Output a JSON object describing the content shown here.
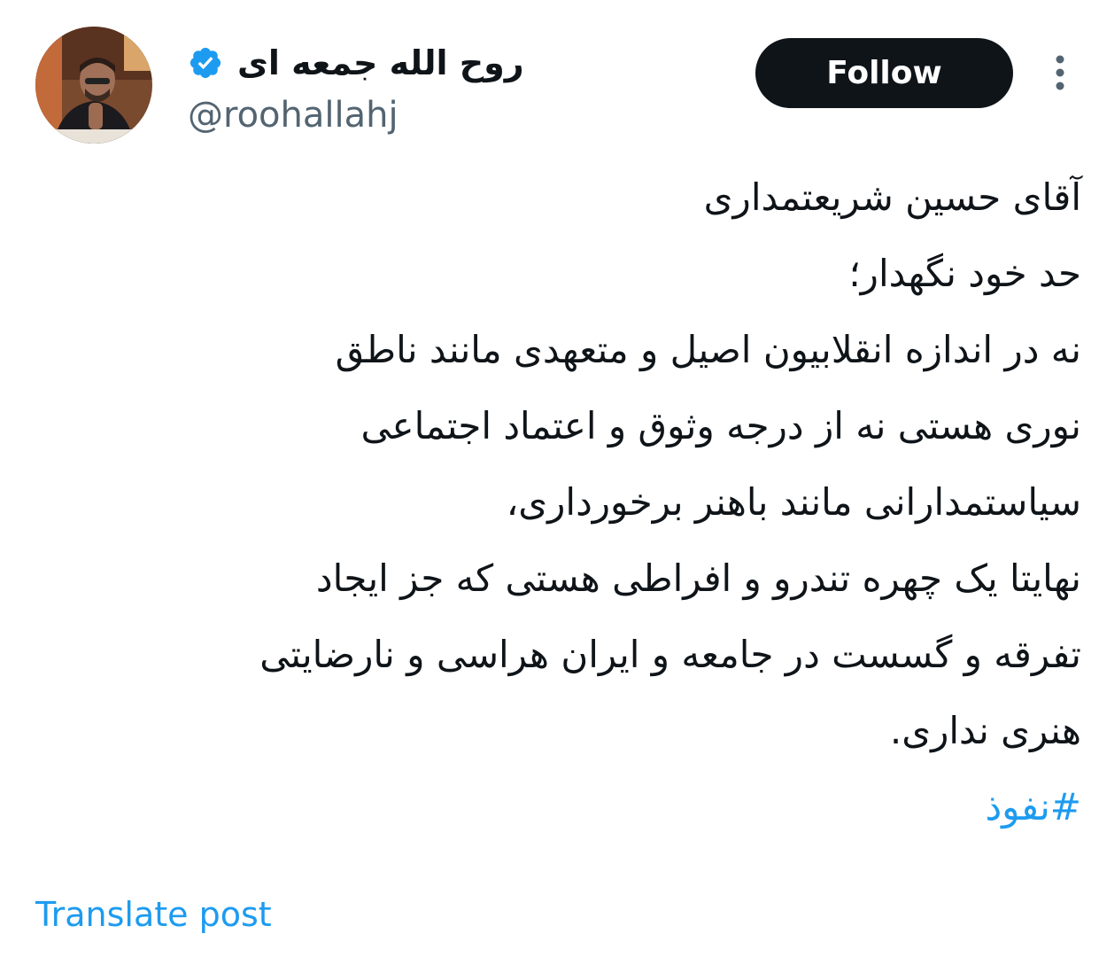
{
  "author": {
    "display_name": "روح الله جمعه ای",
    "handle": "@roohallahj",
    "verified": true,
    "avatar": "portrait-photo"
  },
  "actions": {
    "follow_label": "Follow",
    "more_icon": "more-vertical-icon"
  },
  "tweet": {
    "lines": [
      "آقای حسین شریعتمداری",
      "حد خود نگهدار؛",
      "نه در اندازه انقلابیون اصیل و متعهدی مانند ناطق",
      "نوری هستی نه از درجه وثوق و اعتماد اجتماعی",
      "سیاستمدارانی مانند باهنر برخورداری،",
      "نهایتا یک چهره تندرو و افراطی هستی که جز ایجاد",
      "تفرقه و گسست در جامعه و ایران هراسی و نارضایتی",
      "هنری نداری."
    ],
    "hashtag": "#نفوذ"
  },
  "footer": {
    "translate_label": "Translate post"
  },
  "colors": {
    "link": "#1d9bf0",
    "text": "#0f1419",
    "secondary": "#536471",
    "button_bg": "#0f1419",
    "button_text": "#ffffff"
  }
}
